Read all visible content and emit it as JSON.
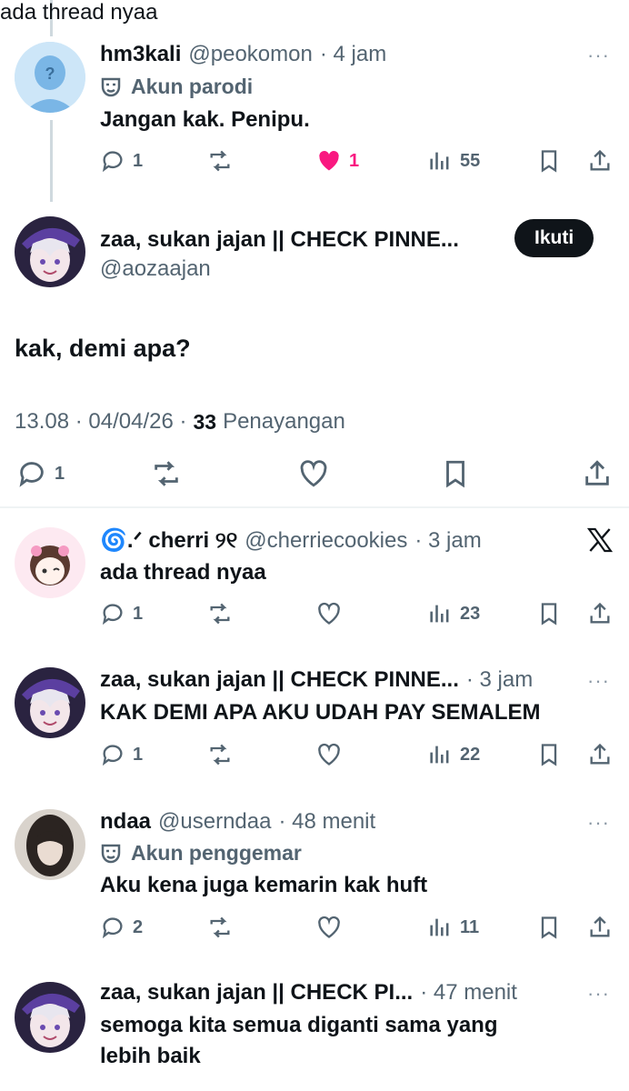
{
  "reply1": {
    "name": "hm3kali",
    "handle": "@peokomon",
    "time": "· 4 jam",
    "badge": "Akun parodi",
    "text": "Jangan kak. Penipu.",
    "replies": "1",
    "likes": "1",
    "views": "55"
  },
  "main": {
    "name": "zaa, sukan jajan || CHECK PINNE...",
    "handle": "@aozaajan",
    "follow_label": "Ikuti",
    "text": "kak, demi apa?",
    "time": "13.08 · 04/04/26 ·",
    "views_count": "33",
    "views_label": "Penayangan",
    "replies": "1"
  },
  "reply2": {
    "name": "🌀.ᐟ cherri ୨୧",
    "handle": "@cherriecookies",
    "time": "· 3 jam",
    "text": "ada thread nyaa",
    "replies": "1",
    "views": "23"
  },
  "reply3": {
    "name": "zaa, sukan jajan || CHECK PINNE...",
    "time": "· 3 jam",
    "text": "KAK DEMI APA AKU UDAH PAY SEMALEM",
    "replies": "1",
    "views": "22"
  },
  "reply4": {
    "name": "ndaa",
    "handle": "@userndaa",
    "time": "· 48 menit",
    "badge": "Akun penggemar",
    "text": "Aku kena juga kemarin kak huft",
    "replies": "2",
    "views": "11"
  },
  "reply5": {
    "name": "zaa, sukan jajan || CHECK PI...",
    "time": "· 47 menit",
    "text_line1": "semoga kita semua diganti sama yang",
    "text_line2": "lebih baik"
  },
  "more_label": "···",
  "colors": {
    "like": "#f91880",
    "muted": "#536471",
    "text": "#0f1419"
  }
}
